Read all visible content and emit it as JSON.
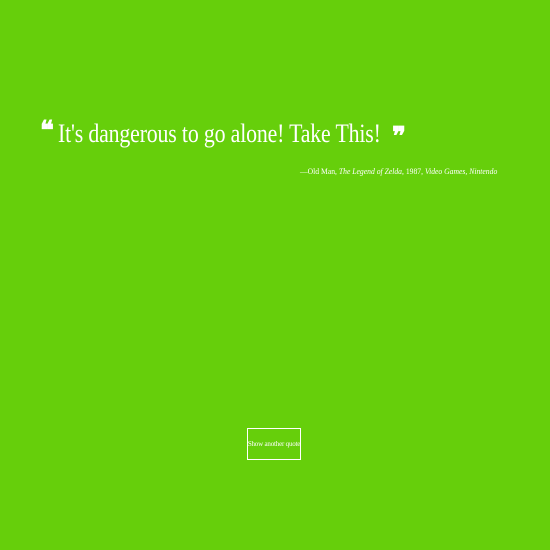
{
  "page": {
    "background_color": "#66cf0b",
    "text_color": "#ffffff"
  },
  "quote": {
    "open_mark": "❝",
    "text": "It's dangerous to go alone! Take This!",
    "close_mark": "❞"
  },
  "attribution": {
    "dash_author": "—Old Man, ",
    "title": "The Legend of Zelda",
    "year": ", 1987, ",
    "category": "Video Games",
    "separator": ", ",
    "publisher": "Nintendo"
  },
  "actions": {
    "new_quote_label": "Show another quote"
  }
}
